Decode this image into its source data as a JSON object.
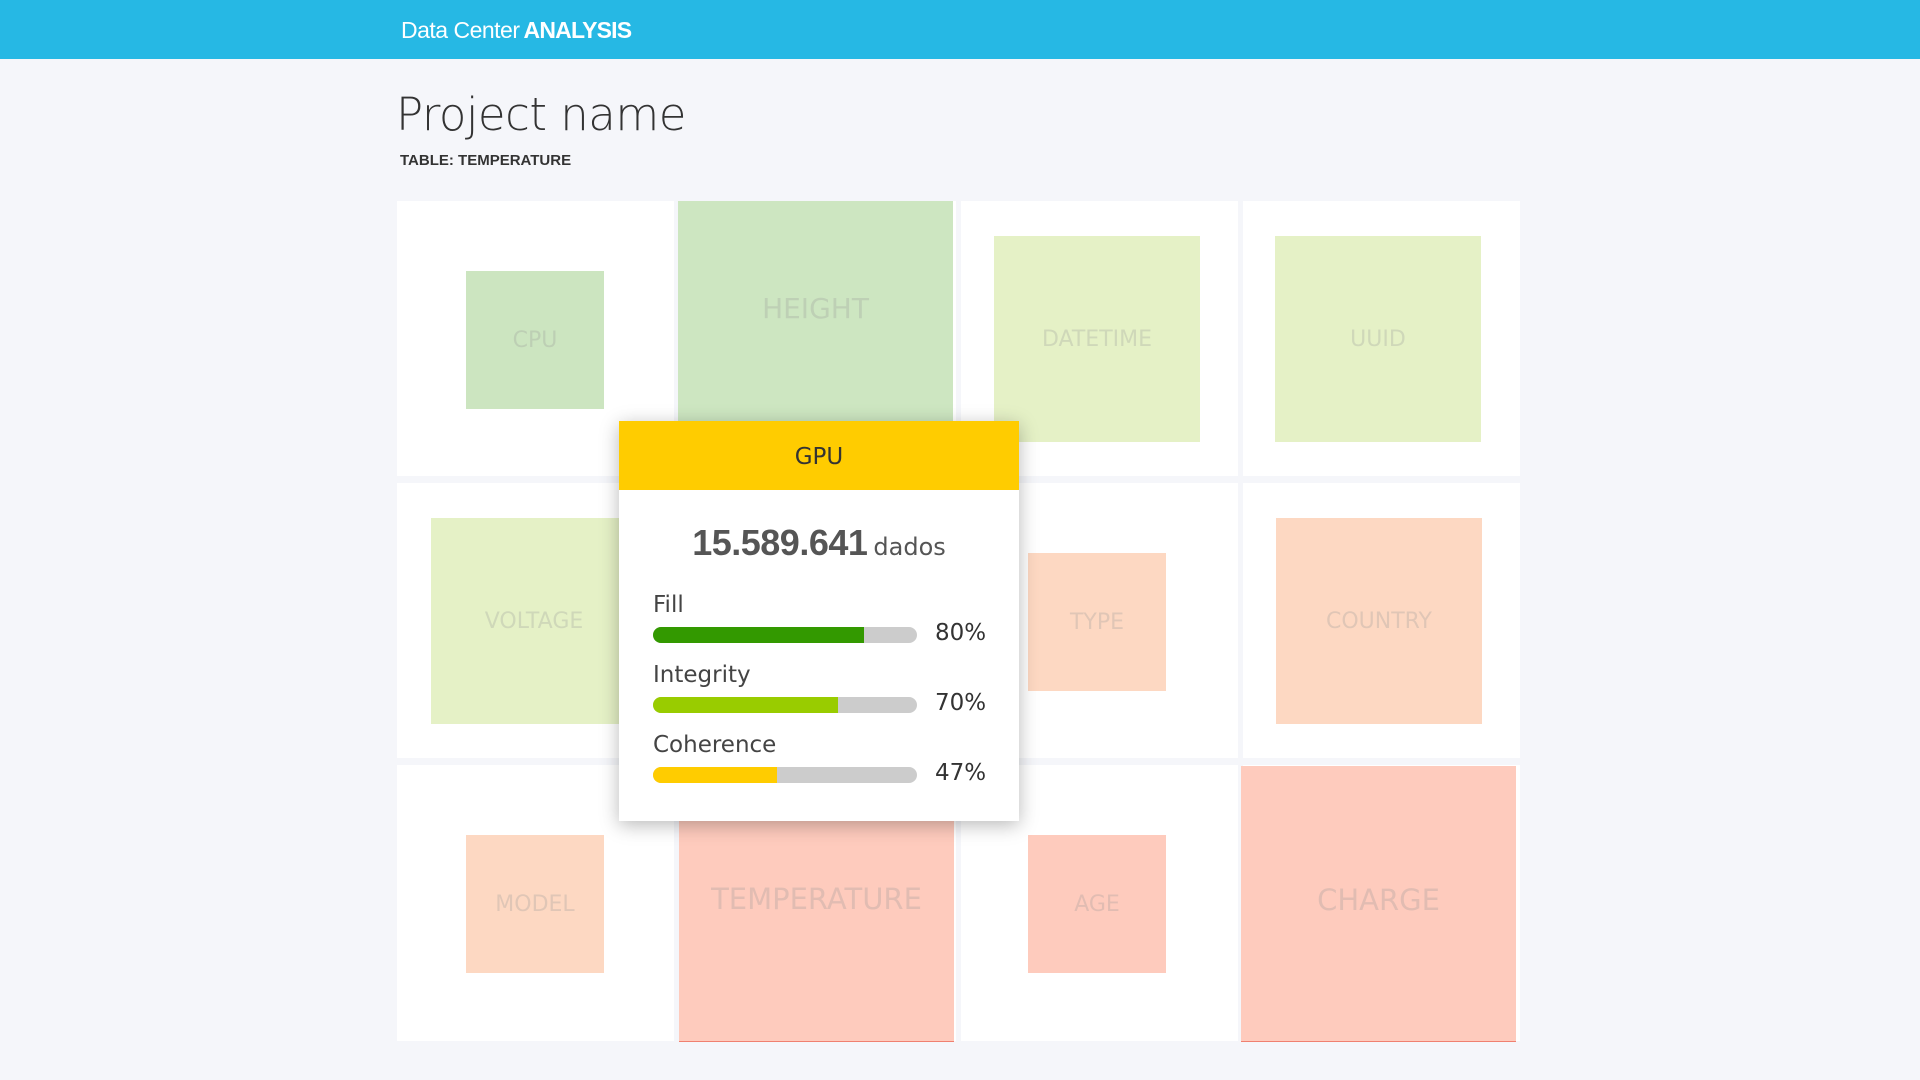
{
  "header": {
    "brand_light": "Data Center",
    "brand_bold": "ANALYSIS",
    "background": "#26b8e4"
  },
  "page": {
    "title": "Project name",
    "subtitle": "TABLE: TEMPERATURE"
  },
  "tiles": [
    {
      "label": "CPU",
      "color": "#cce5c0"
    },
    {
      "label": "HEIGHT",
      "color": "#cde6c1"
    },
    {
      "label": "DATETIME",
      "color": "#e5f1c6"
    },
    {
      "label": "UUID",
      "color": "#e5f1c6"
    },
    {
      "label": "VOLTAGE",
      "color": "#e5f1c6"
    },
    {
      "label": "TYPE",
      "color": "#fdd8c2"
    },
    {
      "label": "COUNTRY",
      "color": "#fdd8c2"
    },
    {
      "label": "MODEL",
      "color": "#fdd8c2"
    },
    {
      "label": "TEMPERATURE",
      "color": "#fecbbd"
    },
    {
      "label": "AGE",
      "color": "#fecbbd"
    },
    {
      "label": "CHARGE",
      "color": "#fecbbd"
    }
  ],
  "tooltip": {
    "title": "GPU",
    "header_color": "#ffcc00",
    "count": "15.589.641",
    "count_unit": "dados",
    "metrics": [
      {
        "label": "Fill",
        "value_text": "80%",
        "value": 80,
        "color": "#339900"
      },
      {
        "label": "Integrity",
        "value_text": "70%",
        "value": 70,
        "color": "#99cc00"
      },
      {
        "label": "Coherence",
        "value_text": "47%",
        "value": 47,
        "color": "#ffcc00"
      }
    ]
  }
}
